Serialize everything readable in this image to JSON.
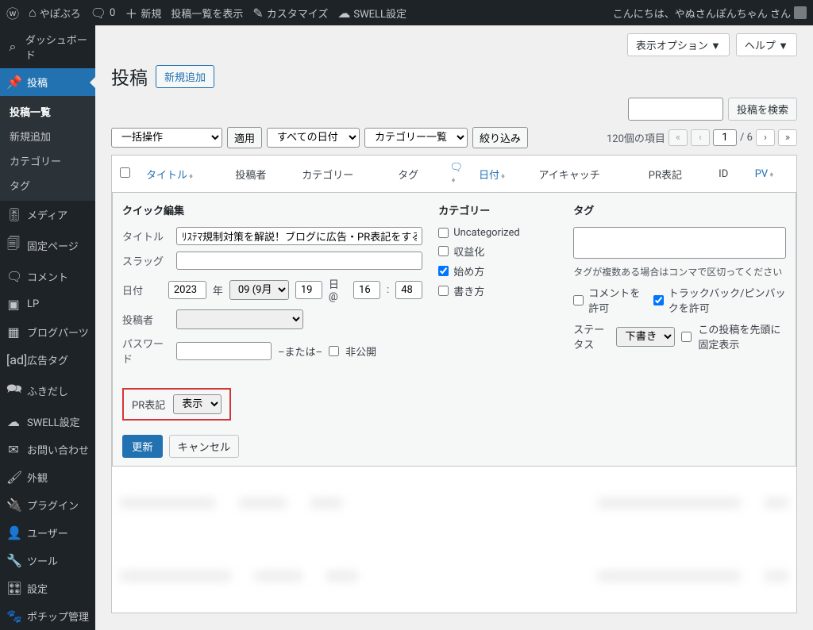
{
  "adminbar": {
    "site": "やぽぶろ",
    "comments": "0",
    "new": "新規",
    "show_posts": "投稿一覧を表示",
    "customize": "カスタマイズ",
    "swell": "SWELL設定",
    "greeting": "こんにちは、やぬさんぽんちゃん さん"
  },
  "sidebar": {
    "dashboard": "ダッシュボード",
    "posts": "投稿",
    "sub": {
      "all": "投稿一覧",
      "new": "新規追加",
      "cat": "カテゴリー",
      "tag": "タグ"
    },
    "media": "メディア",
    "pages": "固定ページ",
    "comments": "コメント",
    "lp": "LP",
    "blogparts": "ブログパーツ",
    "adtag": "広告タグ",
    "fukidashi": "ふきだし",
    "swell": "SWELL設定",
    "contact": "お問い合わせ",
    "appearance": "外観",
    "plugins": "プラグイン",
    "users": "ユーザー",
    "tools": "ツール",
    "settings": "設定",
    "pochip": "ポチップ管理"
  },
  "page": {
    "title": "投稿",
    "add_new": "新規追加",
    "screen_options": "表示オプション ▼",
    "help": "ヘルプ ▼",
    "search": "投稿を検索",
    "bulk": "一括操作",
    "apply": "適用",
    "all_dates": "すべての日付",
    "cat_filter": "カテゴリー一覧",
    "filter": "絞り込み",
    "items_count": "120個の項目",
    "page_total": "/ 6",
    "page_current": "1"
  },
  "columns": {
    "title": "タイトル",
    "author": "投稿者",
    "category": "カテゴリー",
    "tag": "タグ",
    "date": "日付",
    "eyecatch": "アイキャッチ",
    "pr": "PR表記",
    "id": "ID",
    "pv": "PV"
  },
  "quick_edit": {
    "title": "クイック編集",
    "labels": {
      "title": "タイトル",
      "slug": "スラッグ",
      "date": "日付",
      "author": "投稿者",
      "password": "パスワード",
      "or": "–または–",
      "private": "非公開",
      "categories": "カテゴリー",
      "tags": "タグ"
    },
    "post_title": "ﾘｽﾃﾏ規制対策を解説！ブログに広告・PR表記をする方法",
    "slug": "",
    "date": {
      "year": "2023",
      "ysuf": "年",
      "month": "09 (9月)",
      "day": "19",
      "dsuf": "日 @",
      "hour": "16",
      "min": "48"
    },
    "categories": [
      {
        "label": "Uncategorized",
        "checked": false
      },
      {
        "label": "収益化",
        "checked": false
      },
      {
        "label": "始め方",
        "checked": true
      },
      {
        "label": "書き方",
        "checked": false
      }
    ],
    "tag_help": "タグが複数ある場合はコンマで区切ってください",
    "allow_comments": "コメントを許可",
    "allow_ping": "トラックバック/ピンバックを許可",
    "status_label": "ステータス",
    "status_value": "下書き",
    "sticky": "この投稿を先頭に固定表示",
    "pr_label": "PR表記",
    "pr_value": "表示",
    "update": "更新",
    "cancel": "キャンセル"
  }
}
